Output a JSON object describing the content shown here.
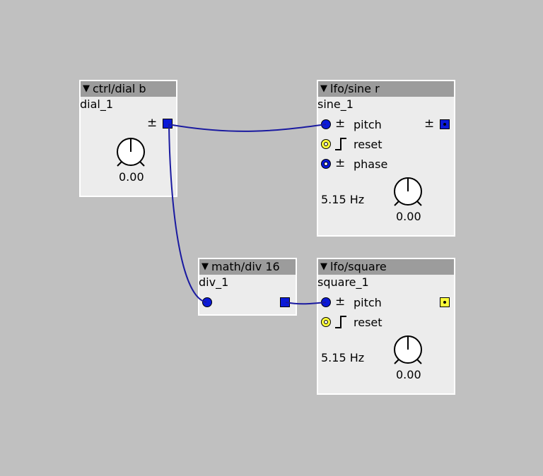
{
  "colors": {
    "canvas": "#c0c0c0",
    "node_body": "#ececec",
    "node_header": "#9c9c9c",
    "port_frac": "#0b1ad8",
    "port_bool": "#ffff3a",
    "wire": "#1a1aa0"
  },
  "icons": {
    "collapse": "▼",
    "bipolar": "±",
    "step": "step-icon"
  },
  "nodes": {
    "dial": {
      "type": "ctrl/dial b",
      "name": "dial_1",
      "value": "0.00"
    },
    "sine": {
      "type": "lfo/sine r",
      "name": "sine_1",
      "inlets": [
        "pitch",
        "reset",
        "phase"
      ],
      "freq": "5.15 Hz",
      "value": "0.00"
    },
    "div": {
      "type": "math/div 16",
      "name": "div_1"
    },
    "square": {
      "type": "lfo/square",
      "name": "square_1",
      "inlets": [
        "pitch",
        "reset"
      ],
      "freq": "5.15 Hz",
      "value": "0.00"
    }
  }
}
